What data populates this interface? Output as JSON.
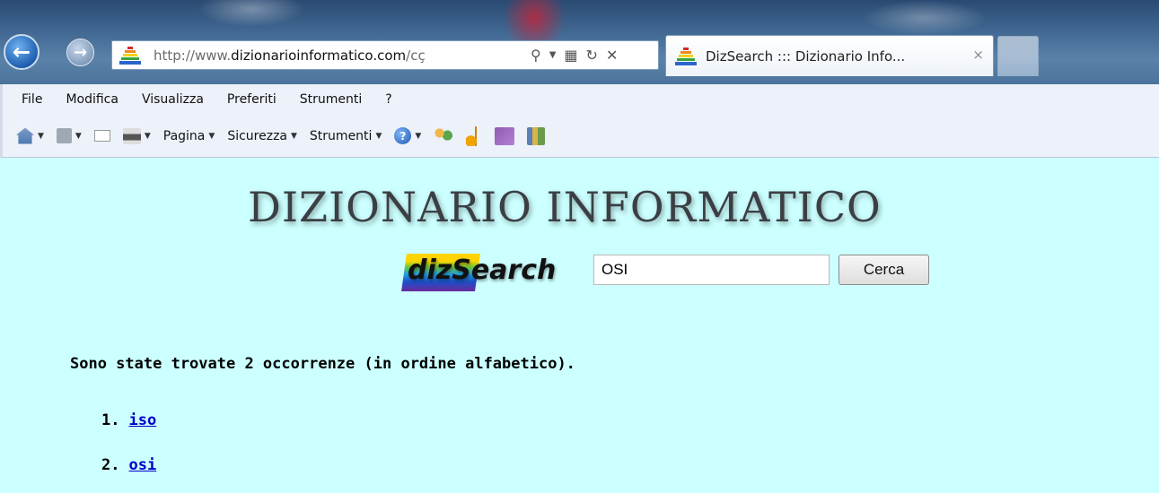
{
  "browser": {
    "address_prefix": "http://www.",
    "address_domain": "dizionarioinformatico.com",
    "address_suffix": "/cç",
    "tab_title": "DizSearch ::: Dizionario Info...",
    "tab_close": "×",
    "icons": {
      "back": "arrow-left-icon",
      "forward": "arrow-right-icon",
      "search": "search-icon",
      "compat": "compatibility-view-icon",
      "refresh": "refresh-icon",
      "stop": "close-icon"
    }
  },
  "menu": {
    "items": [
      "File",
      "Modifica",
      "Visualizza",
      "Preferiti",
      "Strumenti",
      "?"
    ]
  },
  "command_bar": {
    "page_label": "Pagina",
    "security_label": "Sicurezza",
    "tools_label": "Strumenti"
  },
  "page": {
    "background": "#ccffff",
    "logo_title": "DIZIONARIO  INFORMATICO",
    "search_logo": "dizSearch",
    "search_value": "OSI",
    "search_button": "Cerca",
    "results_summary": "Sono state trovate 2 occorrenze (in ordine alfabetico).",
    "results": [
      {
        "num": "1.",
        "label": "iso"
      },
      {
        "num": "2.",
        "label": "osi"
      }
    ],
    "link_color": "#0000cc"
  }
}
